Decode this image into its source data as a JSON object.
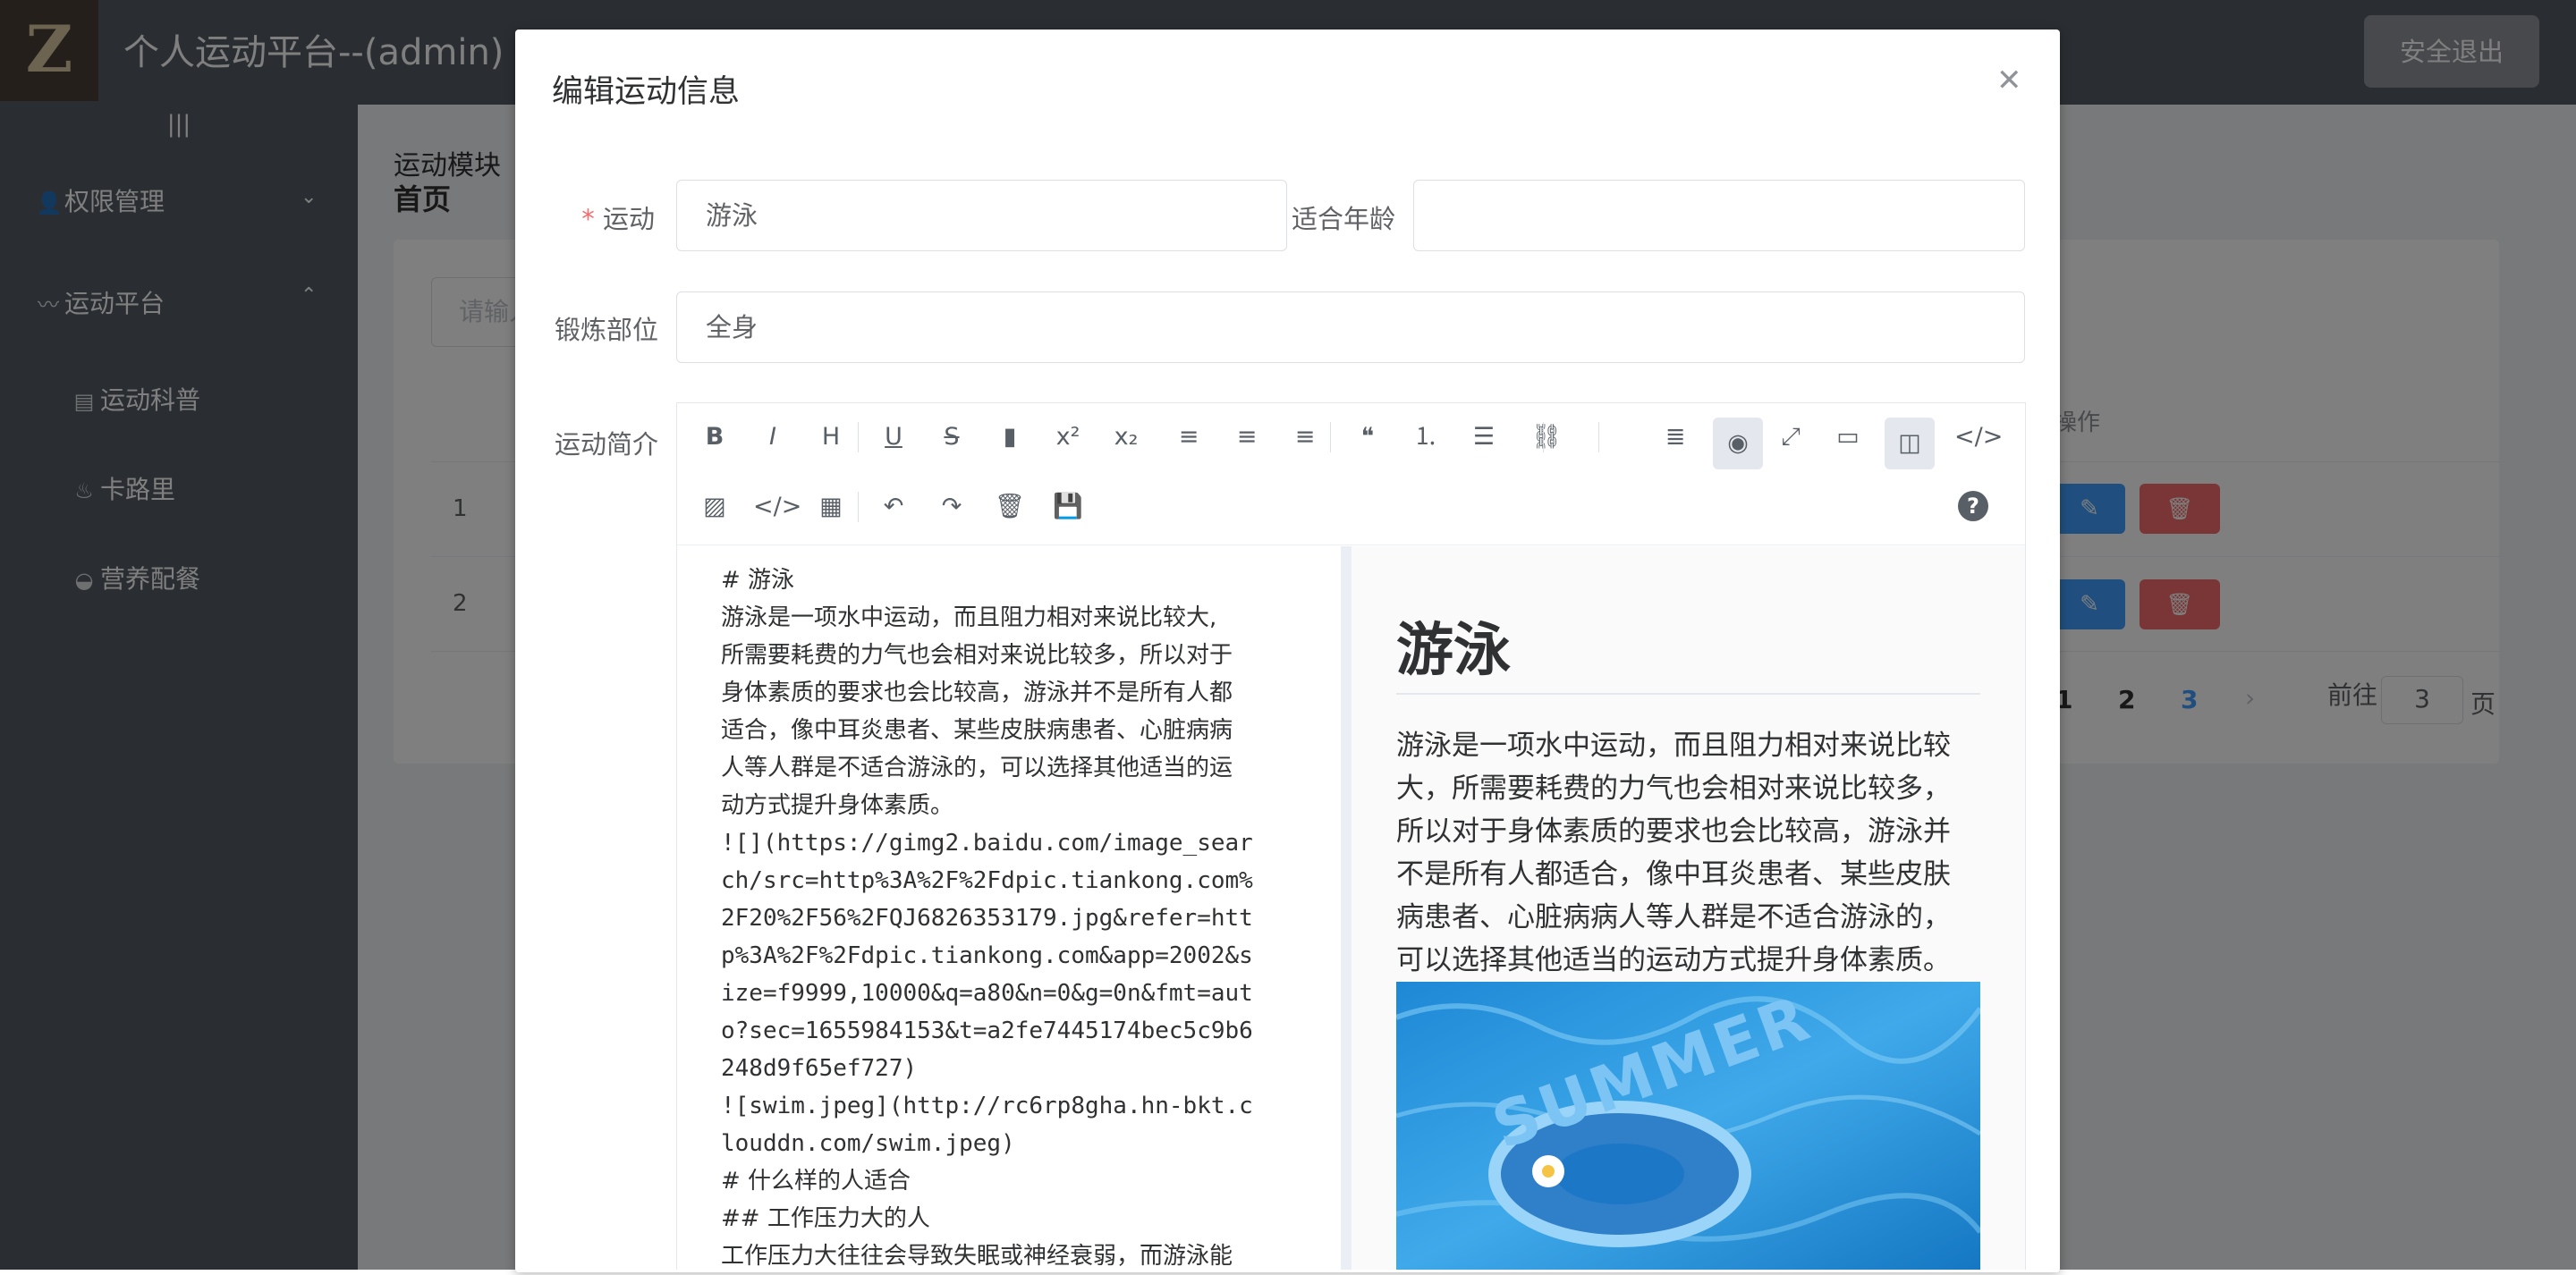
{
  "app": {
    "title": "个人运动平台--(admin)",
    "logo_letter": "Z",
    "logout_label": "安全退出",
    "collapse_icon": "|||"
  },
  "sidebar": {
    "items": [
      {
        "label": "权限管理",
        "icon": "user-icon",
        "expanded": false
      },
      {
        "label": "运动平台",
        "icon": "pulse-icon",
        "expanded": true
      }
    ],
    "subitems": [
      {
        "label": "运动科普",
        "icon": "document-icon"
      },
      {
        "label": "卡路里",
        "icon": "flame-icon"
      },
      {
        "label": "营养配餐",
        "icon": "dish-icon"
      }
    ]
  },
  "main": {
    "breadcrumb_title": "运动模块",
    "breadcrumb_home": "首页",
    "search_placeholder": "请输入",
    "column_ops": "操作",
    "rows": [
      {
        "no": "1"
      },
      {
        "no": "2"
      }
    ],
    "pagination": {
      "pages": [
        "1",
        "2",
        "3"
      ],
      "current": "3",
      "goto_label": "前往",
      "goto_value": "3",
      "page_suffix": "页"
    }
  },
  "dialog": {
    "title": "编辑运动信息",
    "fields": {
      "sport_label": "运动",
      "sport_value": "游泳",
      "age_label": "适合年龄",
      "age_value": "",
      "part_label": "锻炼部位",
      "part_value": "全身",
      "intro_label": "运动简介"
    },
    "editor": {
      "toolbar_row1": [
        {
          "name": "bold-icon",
          "glyph": "B"
        },
        {
          "name": "italic-icon",
          "glyph": "I"
        },
        {
          "name": "heading-icon",
          "glyph": "H"
        },
        {
          "name": "underline-icon",
          "glyph": "U"
        },
        {
          "name": "strikethrough-icon",
          "glyph": "S"
        },
        {
          "name": "bookmark-icon",
          "glyph": "▮"
        },
        {
          "name": "superscript-icon",
          "glyph": "x²"
        },
        {
          "name": "subscript-icon",
          "glyph": "x₂"
        },
        {
          "name": "align-left-icon",
          "glyph": "≡"
        },
        {
          "name": "align-center-icon",
          "glyph": "≡"
        },
        {
          "name": "align-right-icon",
          "glyph": "≡"
        },
        {
          "name": "quote-icon",
          "glyph": "❝"
        },
        {
          "name": "ordered-list-icon",
          "glyph": "⒈"
        },
        {
          "name": "unordered-list-icon",
          "glyph": "☰"
        },
        {
          "name": "link-icon",
          "glyph": "⛓"
        }
      ],
      "toolbar_row1_right": [
        {
          "name": "navigation-icon",
          "glyph": "≣"
        },
        {
          "name": "preview-toggle-icon",
          "glyph": "◉"
        },
        {
          "name": "fullscreen-icon",
          "glyph": "⤢"
        },
        {
          "name": "window-icon",
          "glyph": "▭"
        },
        {
          "name": "split-view-icon",
          "glyph": "◫"
        },
        {
          "name": "html-code-icon",
          "glyph": "</>"
        }
      ],
      "toolbar_row2": [
        {
          "name": "image-icon",
          "glyph": "▨"
        },
        {
          "name": "code-icon",
          "glyph": "</>"
        },
        {
          "name": "table-icon",
          "glyph": "▦"
        },
        {
          "name": "undo-icon",
          "glyph": "↶"
        },
        {
          "name": "redo-icon",
          "glyph": "↷"
        },
        {
          "name": "trash-icon",
          "glyph": "🗑"
        },
        {
          "name": "save-icon",
          "glyph": "💾"
        }
      ],
      "help_icon": "?",
      "markdown_lines": [
        "# 游泳",
        "游泳是一项水中运动，而且阻力相对来说比较大,",
        "所需要耗费的力气也会相对来说比较多，所以对于",
        "身体素质的要求也会比较高，游泳并不是所有人都",
        "适合，像中耳炎患者、某些皮肤病患者、心脏病病",
        "人等人群是不适合游泳的，可以选择其他适当的运",
        "动方式提升身体素质。",
        "![](https://gimg2.baidu.com/image_sear",
        "ch/src=http%3A%2F%2Fdpic.tiankong.com%",
        "2F20%2F56%2FQJ6826353179.jpg&refer=htt",
        "p%3A%2F%2Fdpic.tiankong.com&app=2002&s",
        "ize=f9999,10000&q=a80&n=0&g=0n&fmt=aut",
        "o?sec=1655984153&t=a2fe7445174bec5c9b6",
        "248d9f65ef727)",
        "![swim.jpeg](http://rc6rp8gha.hn-bkt.c",
        "louddn.com/swim.jpeg)",
        "# 什么样的人适合",
        "## 工作压力大的人",
        "工作压力大往往会导致失眠或神经衰弱，而游泳能"
      ],
      "preview": {
        "heading": "游泳",
        "lines": [
          "游泳是一项水中运动，而且阻力相对来说比较",
          "大，所需要耗费的力气也会相对来说比较多，",
          "所以对于身体素质的要求也会比较高，游泳并",
          "不是所有人都适合，像中耳炎患者、某些皮肤",
          "病患者、心脏病病人等人群是不适合游泳的，",
          "可以选择其他适当的运动方式提升身体素质。"
        ],
        "image_text": "SUMMER"
      }
    }
  }
}
